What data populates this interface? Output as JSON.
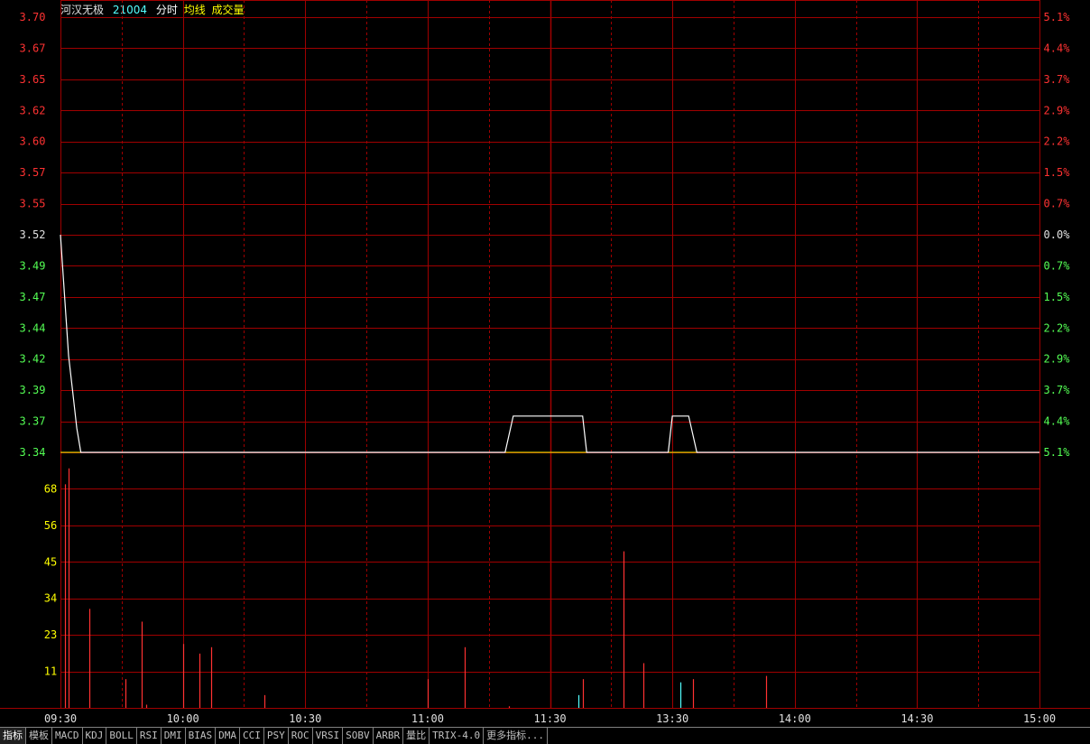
{
  "header": {
    "stock_name": "河汉无极",
    "stock_code": "21004",
    "mode_label": "分时",
    "avg_label": "均线",
    "volume_label": "成交量"
  },
  "colors": {
    "up": "#ff3232",
    "down": "#54ff54",
    "flat": "#e0e0e0",
    "grid": "#a00000",
    "price_line": "#ffffff",
    "avg_line": "#ffff00",
    "vol_label": "#ffff00",
    "volume_down": "#54ffff"
  },
  "tabs": [
    "指标",
    "模板",
    "MACD",
    "KDJ",
    "BOLL",
    "RSI",
    "DMI",
    "BIAS",
    "DMA",
    "CCI",
    "PSY",
    "ROC",
    "VRSI",
    "SOBV",
    "ARBR",
    "量比",
    "TRIX-4.0",
    "更多指标..."
  ],
  "chart_data": {
    "type": "line",
    "x_ticks": [
      "09:30",
      "10:00",
      "10:30",
      "11:00",
      "11:30",
      "13:30",
      "14:00",
      "14:30",
      "15:00"
    ],
    "price_ticks": [
      "3.70",
      "3.67",
      "3.65",
      "3.62",
      "3.60",
      "3.57",
      "3.55",
      "3.52",
      "3.49",
      "3.47",
      "3.44",
      "3.42",
      "3.39",
      "3.37",
      "3.34"
    ],
    "pct_ticks": [
      "5.1%",
      "4.4%",
      "3.7%",
      "2.9%",
      "2.2%",
      "1.5%",
      "0.7%",
      "0.0%",
      "0.7%",
      "1.5%",
      "2.2%",
      "2.9%",
      "3.7%",
      "4.4%",
      "5.1%"
    ],
    "price_range": [
      3.34,
      3.7
    ],
    "prev_close": 3.52,
    "volume_ticks": [
      "68",
      "56",
      "45",
      "34",
      "23",
      "11"
    ],
    "volume_range": [
      0,
      80
    ],
    "price_series": [
      {
        "t": 0,
        "p": 3.52
      },
      {
        "t": 1,
        "p": 3.47
      },
      {
        "t": 2,
        "p": 3.42
      },
      {
        "t": 3,
        "p": 3.39
      },
      {
        "t": 4,
        "p": 3.36
      },
      {
        "t": 5,
        "p": 3.34
      },
      {
        "t": 109,
        "p": 3.34
      },
      {
        "t": 111,
        "p": 3.37
      },
      {
        "t": 120,
        "p": 3.37
      },
      {
        "t": 121,
        "p": 3.37
      },
      {
        "t": 128,
        "p": 3.37
      },
      {
        "t": 129,
        "p": 3.34
      },
      {
        "t": 149,
        "p": 3.34
      },
      {
        "t": 150,
        "p": 3.37
      },
      {
        "t": 154,
        "p": 3.37
      },
      {
        "t": 156,
        "p": 3.34
      },
      {
        "t": 240,
        "p": 3.34
      }
    ],
    "avg_series": [
      {
        "t": 0,
        "p": 3.34
      },
      {
        "t": 240,
        "p": 3.34
      }
    ],
    "volume_bars": [
      {
        "t": 1,
        "v": 70,
        "dir": "up"
      },
      {
        "t": 2,
        "v": 75,
        "dir": "up"
      },
      {
        "t": 7,
        "v": 31,
        "dir": "up"
      },
      {
        "t": 16,
        "v": 9,
        "dir": "up"
      },
      {
        "t": 20,
        "v": 27,
        "dir": "up"
      },
      {
        "t": 21,
        "v": 1,
        "dir": "up"
      },
      {
        "t": 30,
        "v": 20,
        "dir": "up"
      },
      {
        "t": 34,
        "v": 17,
        "dir": "up"
      },
      {
        "t": 37,
        "v": 19,
        "dir": "up"
      },
      {
        "t": 50,
        "v": 4,
        "dir": "up"
      },
      {
        "t": 90,
        "v": 9,
        "dir": "up"
      },
      {
        "t": 99,
        "v": 19,
        "dir": "up"
      },
      {
        "t": 110,
        "v": 0.5,
        "dir": "up"
      },
      {
        "t": 127,
        "v": 4,
        "dir": "down"
      },
      {
        "t": 128,
        "v": 9,
        "dir": "up"
      },
      {
        "t": 138,
        "v": 49,
        "dir": "up"
      },
      {
        "t": 143,
        "v": 14,
        "dir": "up"
      },
      {
        "t": 152,
        "v": 8,
        "dir": "down"
      },
      {
        "t": 155,
        "v": 9,
        "dir": "up"
      },
      {
        "t": 173,
        "v": 10,
        "dir": "up"
      }
    ]
  }
}
